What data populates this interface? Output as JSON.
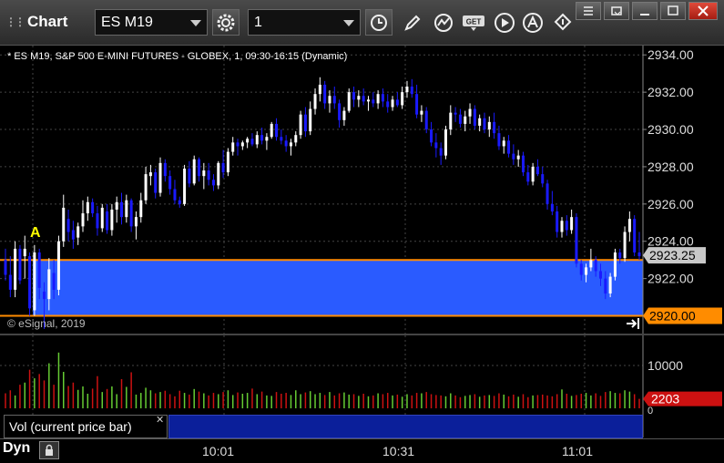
{
  "window": {
    "title": "Chart",
    "symbol": "ES M19",
    "interval": "1"
  },
  "chart": {
    "info_line": "* ES M19, S&P 500 E-MINI FUTURES - GLOBEX, 1, 09:30-16:15 (Dynamic)",
    "copyright": "© eSignal, 2019",
    "marker_label": "A",
    "colors": {
      "up_candle": "#ffffff",
      "down_candle": "#1a1aff",
      "zone_fill": "#2a5bff",
      "zone_line": "#ff8c00",
      "price_tag_current": "#c8c8c8",
      "price_tag_level": "#ff8c00",
      "vol_up": "#66cc33",
      "vol_down": "#cc1111",
      "vol_tag": "#cc1111"
    },
    "price_axis_labels": [
      "2934.00",
      "2932.00",
      "2930.00",
      "2928.00",
      "2926.00",
      "2924.00",
      "2922.00"
    ],
    "current_price_label": "2923.25",
    "level_price_label": "2920.00",
    "volume_axis_label": "10000",
    "volume_zero_label": "0",
    "current_volume_label": "2203",
    "volume_study_label": "Vol (current price bar)",
    "time_labels": [
      "10:01",
      "10:31",
      "11:01"
    ],
    "bottom_mode": "Dyn"
  },
  "chart_data": {
    "type": "candlestick",
    "price_ylim": [
      2919.0,
      2934.5
    ],
    "zone": [
      2920.0,
      2923.0
    ],
    "candles": [
      [
        2923.0,
        2923.6,
        2921.9,
        2922.2
      ],
      [
        2922.2,
        2923.2,
        2921.0,
        2921.4
      ],
      [
        2921.4,
        2924.0,
        2921.0,
        2923.6
      ],
      [
        2923.6,
        2923.8,
        2921.7,
        2921.9
      ],
      [
        2923.2,
        2924.3,
        2922.0,
        2923.6
      ],
      [
        2923.2,
        2923.4,
        2920.0,
        2920.4
      ],
      [
        2920.3,
        2923.8,
        2920.0,
        2923.4
      ],
      [
        2923.4,
        2923.6,
        2920.9,
        2921.5
      ],
      [
        2921.3,
        2921.8,
        2919.3,
        2920.9
      ],
      [
        2920.9,
        2923.1,
        2920.3,
        2922.5
      ],
      [
        2922.3,
        2923.0,
        2920.9,
        2921.4
      ],
      [
        2921.4,
        2924.3,
        2921.1,
        2924.0
      ],
      [
        2924.0,
        2926.5,
        2923.7,
        2925.8
      ],
      [
        2925.2,
        2925.7,
        2924.0,
        2924.5
      ],
      [
        2924.6,
        2925.1,
        2923.6,
        2924.1
      ],
      [
        2924.2,
        2925.0,
        2923.8,
        2924.8
      ],
      [
        2924.8,
        2926.2,
        2924.5,
        2925.5
      ],
      [
        2925.5,
        2926.4,
        2925.1,
        2926.1
      ],
      [
        2926.1,
        2926.3,
        2925.3,
        2925.5
      ],
      [
        2925.5,
        2925.9,
        2924.3,
        2924.7
      ],
      [
        2924.7,
        2926.0,
        2924.5,
        2925.8
      ],
      [
        2925.6,
        2926.0,
        2924.4,
        2924.6
      ],
      [
        2924.6,
        2926.0,
        2924.3,
        2925.7
      ],
      [
        2925.7,
        2926.4,
        2925.0,
        2926.1
      ],
      [
        2926.1,
        2926.6,
        2924.9,
        2925.3
      ],
      [
        2925.3,
        2926.5,
        2925.0,
        2926.2
      ],
      [
        2926.2,
        2926.3,
        2924.5,
        2924.8
      ],
      [
        2924.8,
        2925.6,
        2924.1,
        2925.3
      ],
      [
        2925.3,
        2926.6,
        2925.0,
        2926.2
      ],
      [
        2926.2,
        2928.0,
        2926.0,
        2927.6
      ],
      [
        2927.5,
        2928.1,
        2927.0,
        2927.7
      ],
      [
        2927.7,
        2927.9,
        2926.3,
        2926.6
      ],
      [
        2926.6,
        2928.5,
        2926.4,
        2928.2
      ],
      [
        2928.2,
        2928.4,
        2927.2,
        2927.5
      ],
      [
        2927.5,
        2927.8,
        2926.5,
        2926.8
      ],
      [
        2926.8,
        2927.3,
        2926.0,
        2926.2
      ],
      [
        2926.2,
        2926.4,
        2925.8,
        2926.0
      ],
      [
        2926.0,
        2928.1,
        2925.9,
        2927.9
      ],
      [
        2927.9,
        2928.3,
        2926.9,
        2927.1
      ],
      [
        2927.1,
        2928.6,
        2927.0,
        2928.4
      ],
      [
        2928.4,
        2928.5,
        2927.2,
        2927.5
      ],
      [
        2927.5,
        2928.2,
        2926.8,
        2927.8
      ],
      [
        2927.8,
        2928.2,
        2927.0,
        2927.3
      ],
      [
        2927.3,
        2927.6,
        2926.7,
        2927.0
      ],
      [
        2927.0,
        2928.3,
        2926.8,
        2928.2
      ],
      [
        2928.2,
        2928.9,
        2927.4,
        2927.7
      ],
      [
        2927.7,
        2929.0,
        2927.5,
        2928.8
      ],
      [
        2928.8,
        2929.6,
        2928.6,
        2929.3
      ],
      [
        2929.3,
        2929.5,
        2928.6,
        2929.1
      ],
      [
        2929.1,
        2929.4,
        2928.9,
        2929.3
      ],
      [
        2929.3,
        2929.6,
        2929.0,
        2929.5
      ],
      [
        2929.5,
        2929.8,
        2929.1,
        2929.2
      ],
      [
        2929.2,
        2929.9,
        2929.0,
        2929.7
      ],
      [
        2929.7,
        2930.1,
        2929.2,
        2929.4
      ],
      [
        2929.4,
        2929.8,
        2928.9,
        2929.6
      ],
      [
        2929.6,
        2930.4,
        2929.5,
        2930.3
      ],
      [
        2930.3,
        2930.6,
        2929.4,
        2929.6
      ],
      [
        2929.6,
        2930.0,
        2929.2,
        2929.4
      ],
      [
        2929.4,
        2929.7,
        2928.8,
        2929.1
      ],
      [
        2929.1,
        2929.5,
        2928.6,
        2929.3
      ],
      [
        2929.3,
        2929.9,
        2929.1,
        2929.7
      ],
      [
        2929.7,
        2931.0,
        2929.5,
        2930.8
      ],
      [
        2930.8,
        2931.2,
        2929.6,
        2929.9
      ],
      [
        2929.9,
        2931.5,
        2929.7,
        2931.1
      ],
      [
        2931.1,
        2932.2,
        2930.8,
        2931.9
      ],
      [
        2931.9,
        2932.8,
        2931.5,
        2932.4
      ],
      [
        2932.4,
        2932.6,
        2931.1,
        2931.4
      ],
      [
        2931.4,
        2932.1,
        2930.9,
        2931.8
      ],
      [
        2931.8,
        2932.3,
        2931.1,
        2931.4
      ],
      [
        2931.4,
        2931.6,
        2930.1,
        2930.5
      ],
      [
        2930.5,
        2931.2,
        2930.2,
        2931.0
      ],
      [
        2931.0,
        2932.2,
        2930.9,
        2932.0
      ],
      [
        2932.0,
        2932.3,
        2931.2,
        2931.6
      ],
      [
        2931.6,
        2932.1,
        2931.2,
        2931.8
      ],
      [
        2931.8,
        2932.2,
        2931.3,
        2931.5
      ],
      [
        2931.5,
        2931.8,
        2931.0,
        2931.6
      ],
      [
        2931.6,
        2932.0,
        2931.2,
        2931.4
      ],
      [
        2931.4,
        2932.1,
        2931.1,
        2931.9
      ],
      [
        2931.9,
        2932.2,
        2931.2,
        2931.5
      ],
      [
        2931.5,
        2931.9,
        2930.9,
        2931.2
      ],
      [
        2931.2,
        2931.8,
        2931.0,
        2931.6
      ],
      [
        2931.6,
        2932.0,
        2931.2,
        2931.3
      ],
      [
        2931.3,
        2932.3,
        2931.1,
        2932.0
      ],
      [
        2932.0,
        2932.6,
        2931.7,
        2932.3
      ],
      [
        2932.3,
        2932.7,
        2931.7,
        2931.9
      ],
      [
        2931.9,
        2932.4,
        2930.6,
        2930.8
      ],
      [
        2930.8,
        2931.3,
        2930.4,
        2931.0
      ],
      [
        2931.0,
        2931.2,
        2929.8,
        2930.0
      ],
      [
        2930.0,
        2930.4,
        2929.1,
        2929.3
      ],
      [
        2929.3,
        2929.8,
        2928.5,
        2929.0
      ],
      [
        2929.0,
        2929.3,
        2928.1,
        2928.6
      ],
      [
        2928.6,
        2930.2,
        2928.4,
        2930.0
      ],
      [
        2930.0,
        2931.3,
        2929.7,
        2930.9
      ],
      [
        2930.9,
        2931.2,
        2930.4,
        2930.8
      ],
      [
        2930.8,
        2931.1,
        2930.1,
        2930.3
      ],
      [
        2930.3,
        2931.0,
        2929.9,
        2930.7
      ],
      [
        2930.7,
        2931.4,
        2930.3,
        2931.1
      ],
      [
        2931.1,
        2931.3,
        2930.0,
        2930.2
      ],
      [
        2930.2,
        2930.8,
        2929.9,
        2930.6
      ],
      [
        2930.6,
        2930.9,
        2929.8,
        2930.0
      ],
      [
        2930.0,
        2930.7,
        2929.6,
        2930.4
      ],
      [
        2930.4,
        2930.9,
        2929.5,
        2929.8
      ],
      [
        2929.8,
        2930.2,
        2928.9,
        2929.1
      ],
      [
        2929.1,
        2929.6,
        2928.7,
        2929.4
      ],
      [
        2929.4,
        2929.7,
        2928.5,
        2928.7
      ],
      [
        2928.7,
        2929.2,
        2928.1,
        2928.4
      ],
      [
        2928.4,
        2928.9,
        2928.0,
        2928.6
      ],
      [
        2928.6,
        2928.8,
        2927.5,
        2927.7
      ],
      [
        2927.7,
        2928.1,
        2927.0,
        2927.2
      ],
      [
        2927.2,
        2928.2,
        2927.0,
        2928.0
      ],
      [
        2928.0,
        2928.4,
        2927.5,
        2927.6
      ],
      [
        2927.6,
        2928.0,
        2926.9,
        2927.1
      ],
      [
        2927.1,
        2927.3,
        2925.7,
        2926.0
      ],
      [
        2926.0,
        2926.7,
        2925.4,
        2925.6
      ],
      [
        2925.6,
        2925.9,
        2924.2,
        2924.5
      ],
      [
        2924.5,
        2925.3,
        2924.2,
        2925.1
      ],
      [
        2925.1,
        2925.4,
        2924.3,
        2924.6
      ],
      [
        2924.6,
        2925.7,
        2924.4,
        2925.3
      ],
      [
        2925.3,
        2925.5,
        2922.6,
        2922.8
      ],
      [
        2922.8,
        2923.0,
        2921.9,
        2922.2
      ],
      [
        2922.2,
        2922.8,
        2921.8,
        2922.6
      ],
      [
        2922.6,
        2923.6,
        2922.4,
        2923.0
      ],
      [
        2923.0,
        2923.2,
        2922.1,
        2922.4
      ],
      [
        2922.4,
        2922.8,
        2921.6,
        2922.0
      ],
      [
        2922.0,
        2922.4,
        2920.9,
        2921.2
      ],
      [
        2921.2,
        2922.3,
        2921.0,
        2922.1
      ],
      [
        2922.1,
        2923.6,
        2921.9,
        2923.4
      ],
      [
        2923.4,
        2923.6,
        2922.8,
        2923.1
      ],
      [
        2923.1,
        2924.8,
        2922.9,
        2924.5
      ],
      [
        2924.5,
        2925.6,
        2924.0,
        2925.2
      ],
      [
        2925.2,
        2925.4,
        2923.2,
        2923.4
      ],
      [
        2923.4,
        2924.5,
        2923.0,
        2923.2
      ]
    ],
    "volume_ylim": [
      0,
      17000
    ],
    "volume": [
      3500,
      4200,
      3000,
      5500,
      6000,
      9000,
      7000,
      8000,
      6500,
      10500,
      5500,
      13000,
      8500,
      5200,
      6000,
      4300,
      5100,
      3400,
      4600,
      7500,
      3800,
      4500,
      5100,
      3300,
      6800,
      5000,
      8400,
      3200,
      3600,
      4800,
      4200,
      3500,
      3800,
      4100,
      3300,
      2800,
      4100,
      3600,
      3200,
      4500,
      3900,
      3500,
      3000,
      3600,
      3300,
      3800,
      4200,
      3100,
      3700,
      3400,
      3600,
      4600,
      3300,
      3900,
      3000,
      2900,
      3800,
      3400,
      3600,
      3100,
      4200,
      3300,
      3700,
      4000,
      3300,
      3600,
      3100,
      3800,
      3000,
      3500,
      3700,
      3200,
      3300,
      2900,
      3400,
      2800,
      3000,
      3500,
      3300,
      3600,
      3000,
      3200,
      2700,
      3300,
      3000,
      3600,
      3500,
      3800,
      3300,
      3100,
      3000,
      2800,
      3500,
      3000,
      2600,
      2900,
      3100,
      3300,
      2700,
      3000,
      3100,
      2900,
      3500,
      3200,
      2800,
      3200,
      2700,
      3300,
      2600,
      3000,
      3100,
      3200,
      3000,
      2800,
      3300,
      4400,
      3400,
      2900,
      3100,
      3400,
      3600,
      3000,
      3500,
      2900,
      3800,
      4000,
      3600,
      3500,
      4200,
      3900,
      3300,
      2203
    ]
  }
}
